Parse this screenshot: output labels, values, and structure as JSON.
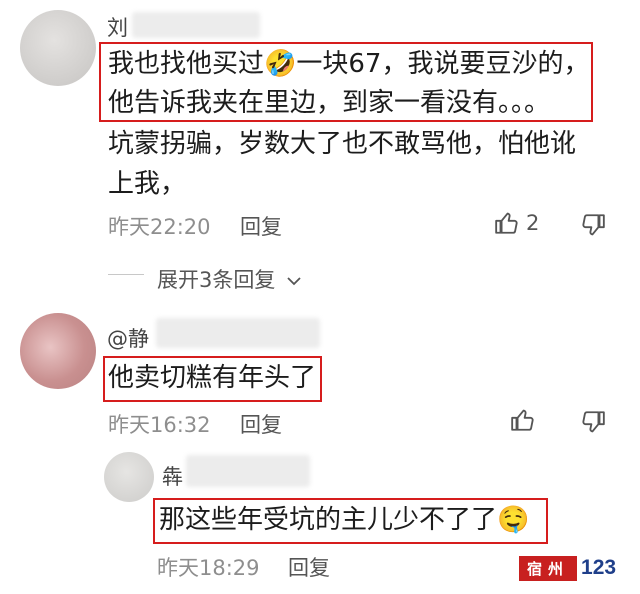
{
  "comments": [
    {
      "username": "刘",
      "lines": [
        "我也找他买过🤣一块67，我说要豆沙的，",
        "他告诉我夹在里边，到家一看没有。。。",
        "坑蒙拐骗，岁数大了也不敢骂他，怕他讹",
        "上我，"
      ],
      "time": "昨天22:20",
      "reply_label": "回复",
      "like_count": "2",
      "expand_label": "展开3条回复"
    },
    {
      "username": "@静",
      "text": "他卖切糕有年头了",
      "time": "昨天16:32",
      "reply_label": "回复"
    },
    {
      "username": "犇",
      "text": "那这些年受坑的主儿少不了了🤤",
      "time": "昨天18:29",
      "reply_label": "回复"
    }
  ],
  "watermark": {
    "seal_text": "宿州",
    "number": "123"
  },
  "colors": {
    "highlight_box": "#d61d1d",
    "meta_text": "#8e8e8e"
  }
}
